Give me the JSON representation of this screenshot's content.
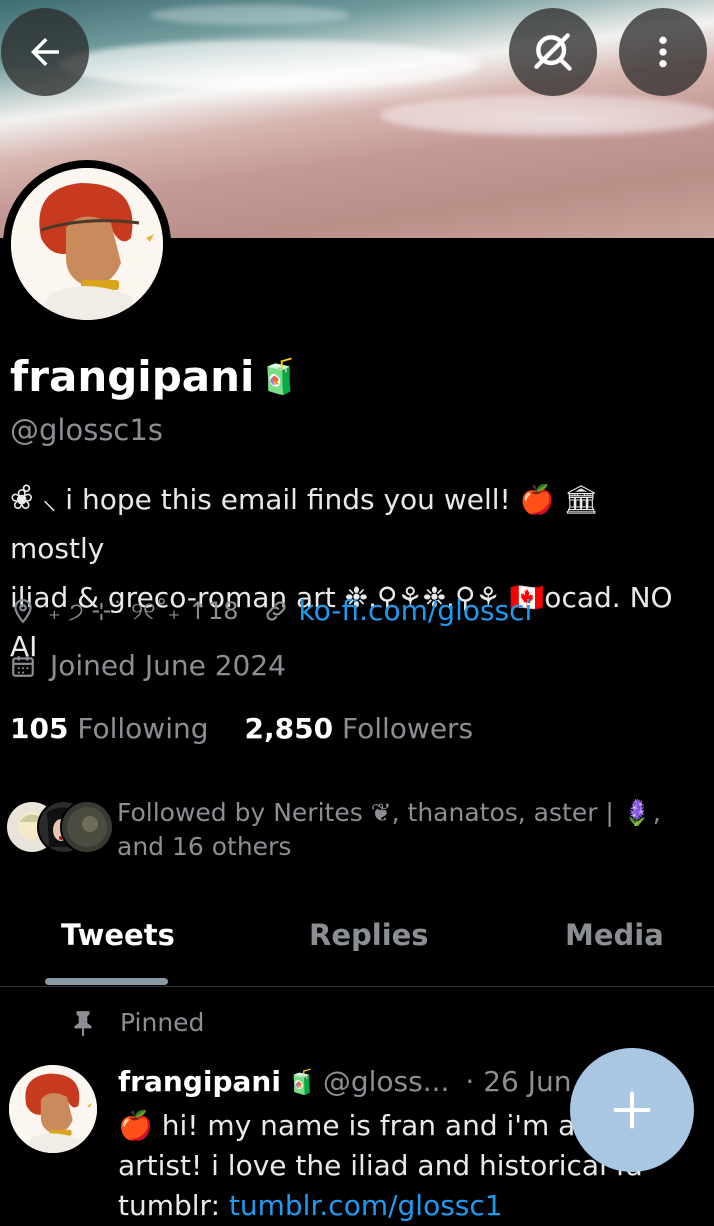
{
  "profile": {
    "name": "frangipani",
    "name_emoji": "🧃",
    "handle": "@glossc1s",
    "bio_line1": "❀̊ ⸜ i hope this email finds you well! 🍎 🏛 mostly",
    "bio_line2": "iliad & greco-roman art ❉.⚲⚘❉.⚲⚘ 🇨🇦ocad. NO AI",
    "location": "₊ ੭ ⊹˙ ୨୧˚₊ ↑18",
    "website": "ko-fi.com/glossci",
    "joined": "Joined June 2024",
    "following_count": "105",
    "following_label": "Following",
    "followers_count": "2,850",
    "followers_label": "Followers",
    "followed_by": "Followed by Nerites ❦, thanatos, aster | 🪻, and 16 others"
  },
  "tabs": [
    {
      "label": "Tweets",
      "active": true
    },
    {
      "label": "Replies",
      "active": false
    },
    {
      "label": "Media",
      "active": false
    }
  ],
  "pinned_label": "Pinned",
  "tweet": {
    "name": "frangipani",
    "name_emoji": "🧃",
    "handle": "@gloss...",
    "date": "· 26 Jun 24",
    "line1": "🍎 hi! my name is fran and i'm a ho",
    "line2": "artist! i love the iliad and historical fa",
    "line3_prefix": "tumblr: ",
    "line3_link": "tumblr.com/glossc1"
  },
  "icons": {
    "back": "arrow-left-icon",
    "search_off": "no-search-icon",
    "more": "more-vertical-icon",
    "location": "location-pin-icon",
    "link": "link-icon",
    "calendar": "calendar-icon",
    "pin": "pin-icon",
    "compose": "plus-icon"
  },
  "colors": {
    "accent": "#1d9bf0",
    "muted": "#8b8f94",
    "fab": "#a9c7e3"
  }
}
